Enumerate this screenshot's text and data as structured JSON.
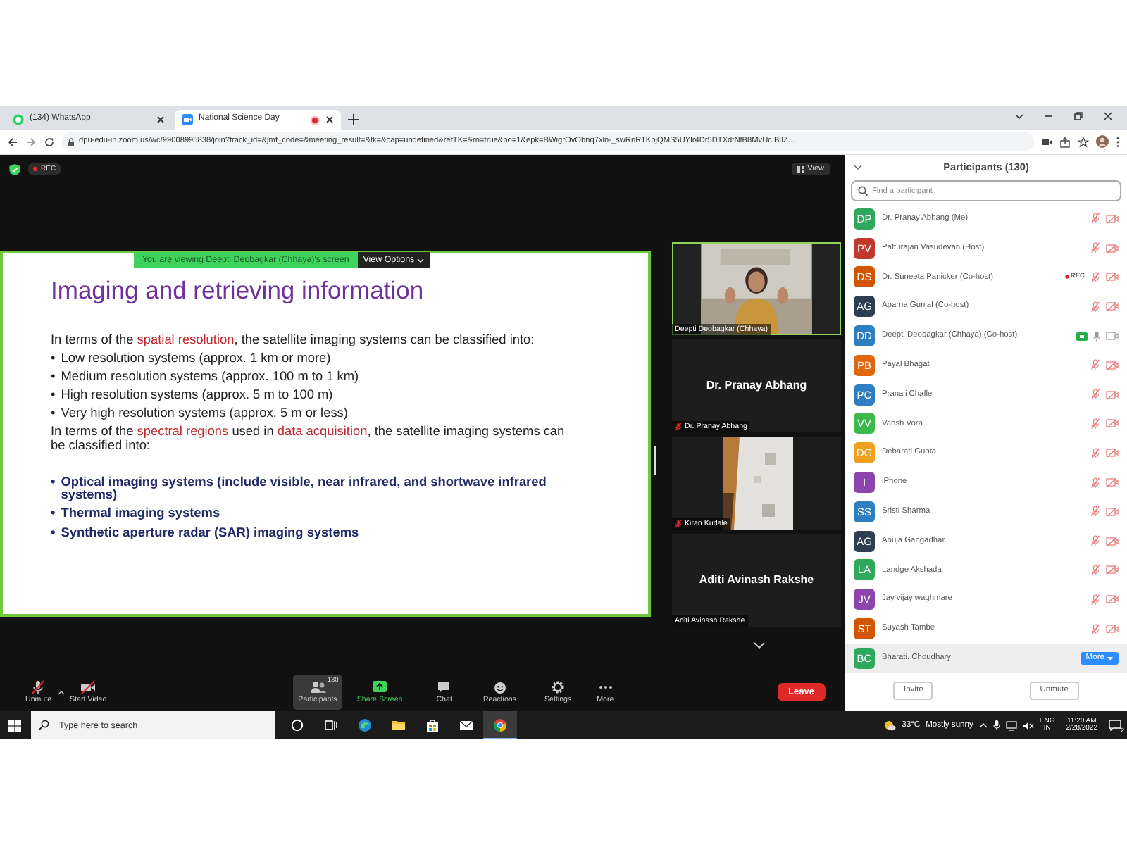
{
  "browser": {
    "tabs": [
      {
        "title": "(134) WhatsApp",
        "kind": "whatsapp",
        "selected": false,
        "recording": false
      },
      {
        "title": "National Science Day",
        "kind": "zoom",
        "selected": true,
        "recording": true
      }
    ],
    "url": "dpu-edu-in.zoom.us/wc/99008995838/join?track_id=&jmf_code=&meeting_result=&tk=&cap=undefined&refTK=&rn=true&po=1&epk=BWigrOvObnq7xln-_swRnRTKbjQMS5UYlr4Dr5DTXdtNfB8MvUc.BJZ..."
  },
  "meeting": {
    "rec_label": "REC",
    "view_button": "View",
    "share_banner": "You are viewing Deepti Deobagkar (Chhaya)'s screen",
    "view_options": "View Options",
    "slide": {
      "title": "Imaging and retrieving information",
      "blocks": [
        {
          "kind": "paragraph",
          "segments": [
            {
              "text": "In terms of the ",
              "highlight": false
            },
            {
              "text": "spatial resolution",
              "highlight": true
            },
            {
              "text": ", the satellite imaging systems can be classified into:",
              "highlight": false
            }
          ]
        },
        {
          "kind": "bullet",
          "bullet": "•",
          "text": "Low resolution systems (approx. 1 km or more)",
          "emphasis": false
        },
        {
          "kind": "bullet",
          "bullet": "•",
          "text": "Medium resolution systems (approx. 100 m to 1 km)",
          "emphasis": false
        },
        {
          "kind": "bullet",
          "bullet": "•",
          "text": "High resolution systems (approx. 5 m to 100 m)",
          "emphasis": false
        },
        {
          "kind": "bullet",
          "bullet": "•",
          "text": "Very high resolution systems (approx. 5 m or less)",
          "emphasis": false
        },
        {
          "kind": "paragraph",
          "segments": [
            {
              "text": "In terms of the ",
              "highlight": false
            },
            {
              "text": "spectral regions",
              "highlight": true
            },
            {
              "text": " used in ",
              "highlight": false
            },
            {
              "text": "data acquisition",
              "highlight": true
            },
            {
              "text": ", the satellite imaging systems can be classified into:",
              "highlight": false
            }
          ]
        },
        {
          "kind": "bullet",
          "bullet": "•",
          "text": "Optical imaging systems (include visible, near infrared, and shortwave infrared systems)",
          "emphasis": true
        },
        {
          "kind": "bullet",
          "bullet": "•",
          "text": "Thermal imaging systems",
          "emphasis": true
        },
        {
          "kind": "bullet",
          "bullet": "•",
          "text": "Synthetic aperture radar (SAR) imaging systems",
          "emphasis": true
        }
      ]
    },
    "videos": [
      {
        "kind": "video",
        "label": "Deepti Deobagkar (Chhaya)",
        "muted": false,
        "selected": true
      },
      {
        "kind": "name",
        "name": "Dr. Pranay Abhang",
        "label": "Dr. Pranay Abhang",
        "muted": true,
        "selected": false
      },
      {
        "kind": "video",
        "label": "Kiran Kudale",
        "muted": true,
        "selected": false
      },
      {
        "kind": "name",
        "name": "Aditi Avinash Rakshe",
        "label": "Aditi Avinash Rakshe",
        "muted": false,
        "selected": false
      }
    ]
  },
  "toolbar": {
    "items": [
      {
        "kind": "mic",
        "label": "Unmute",
        "selected": false
      },
      {
        "kind": "video",
        "label": "Start Video",
        "selected": false
      },
      {
        "kind": "participants",
        "label": "Participants",
        "count": "130",
        "selected": true
      },
      {
        "kind": "share",
        "label": "Share Screen",
        "selected": false
      },
      {
        "kind": "chat",
        "label": "Chat",
        "selected": false
      },
      {
        "kind": "reactions",
        "label": "Reactions",
        "selected": false
      },
      {
        "kind": "settings",
        "label": "Settings",
        "selected": false
      },
      {
        "kind": "more",
        "label": "More",
        "selected": false
      }
    ],
    "leave_button": "Leave"
  },
  "participants_panel": {
    "title": "Participants (130)",
    "search_placeholder": "Find a participant",
    "participants": [
      {
        "initials": "DP",
        "color": "#2ea85a",
        "name": "Dr. Pranay Abhang (Me)",
        "sharing": false,
        "mic_muted": true,
        "video_off": true,
        "selected": false
      },
      {
        "initials": "PV",
        "color": "#c0392b",
        "name": "Patturajan Vasudevan (Host)",
        "sharing": false,
        "mic_muted": true,
        "video_off": true,
        "selected": false
      },
      {
        "initials": "DS",
        "color": "#d35400",
        "name": "Dr. Suneeta Panicker (Co-host)",
        "rec_label": "REC",
        "sharing": false,
        "mic_muted": true,
        "video_off": true,
        "selected": false
      },
      {
        "initials": "AG",
        "color": "#2c3e50",
        "name": "Aparna Gunjal (Co-host)",
        "sharing": false,
        "mic_muted": true,
        "video_off": true,
        "selected": false
      },
      {
        "initials": "DD",
        "color": "#2e7fc1",
        "name": "Deepti Deobagkar (Chhaya) (Co-host)",
        "sharing": true,
        "mic_muted": false,
        "video_off": false,
        "selected": false
      },
      {
        "initials": "PB",
        "color": "#e0670f",
        "name": "Payal Bhagat",
        "sharing": false,
        "mic_muted": true,
        "video_off": true,
        "selected": false
      },
      {
        "initials": "PC",
        "color": "#2e7fc1",
        "name": "Pranali Chafle",
        "sharing": false,
        "mic_muted": true,
        "video_off": true,
        "selected": false
      },
      {
        "initials": "VV",
        "color": "#3cb94a",
        "name": "Vansh Vora",
        "sharing": false,
        "mic_muted": true,
        "video_off": true,
        "selected": false
      },
      {
        "initials": "DG",
        "color": "#f0a01e",
        "name": "Debarati Gupta",
        "sharing": false,
        "mic_muted": true,
        "video_off": true,
        "selected": false
      },
      {
        "initials": "I",
        "color": "#8e44ad",
        "name": "iPhone",
        "sharing": false,
        "mic_muted": true,
        "video_off": true,
        "selected": false
      },
      {
        "initials": "SS",
        "color": "#2e7fc1",
        "name": "Sristi Sharma",
        "sharing": false,
        "mic_muted": true,
        "video_off": true,
        "selected": false
      },
      {
        "initials": "AG",
        "color": "#2c3e50",
        "name": "Anuja Gangadhar",
        "sharing": false,
        "mic_muted": true,
        "video_off": true,
        "selected": false
      },
      {
        "initials": "LA",
        "color": "#2ea85a",
        "name": "Landge Akshada",
        "sharing": false,
        "mic_muted": true,
        "video_off": true,
        "selected": false
      },
      {
        "initials": "JV",
        "color": "#8e44ad",
        "name": "Jay vijay waghmare",
        "sharing": false,
        "mic_muted": true,
        "video_off": true,
        "selected": false
      },
      {
        "initials": "ST",
        "color": "#d35400",
        "name": "Suyash Tambe",
        "sharing": false,
        "mic_muted": true,
        "video_off": true,
        "selected": false
      },
      {
        "initials": "BC",
        "color": "#2ea85a",
        "name": "Bharati. Choudhary",
        "more_button": "More",
        "selected": true
      }
    ],
    "buttons": [
      "Invite",
      "Unmute"
    ]
  },
  "taskbar": {
    "search_placeholder": "Type here to search",
    "apps": [
      {
        "kind": "cortana",
        "selected": false
      },
      {
        "kind": "taskview",
        "selected": false
      },
      {
        "kind": "edge",
        "selected": false
      },
      {
        "kind": "explorer",
        "selected": false
      },
      {
        "kind": "store",
        "selected": false
      },
      {
        "kind": "mail",
        "selected": false
      },
      {
        "kind": "chrome",
        "selected": true
      }
    ],
    "temperature": "33°C",
    "weather": "Mostly sunny",
    "language": "ENG",
    "region": "IN",
    "time": "11:20 AM",
    "date": "2/28/2022",
    "notifications": "2"
  }
}
